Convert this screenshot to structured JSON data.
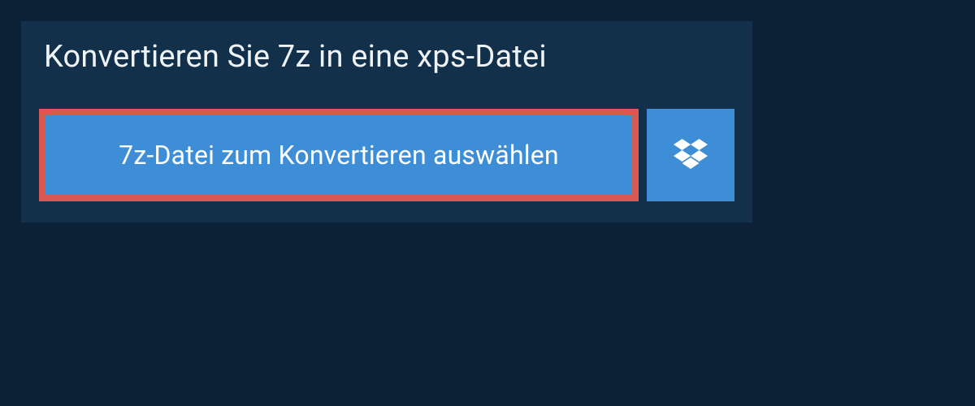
{
  "panel": {
    "title": "Konvertieren Sie 7z in eine xps-Datei",
    "select_button_label": "7z-Datei zum Konvertieren auswählen"
  },
  "colors": {
    "background": "#0c2036",
    "panel": "#13304b",
    "button": "#3d8ed6",
    "highlight_border": "#d85a52",
    "text_light": "#eef3f7"
  }
}
